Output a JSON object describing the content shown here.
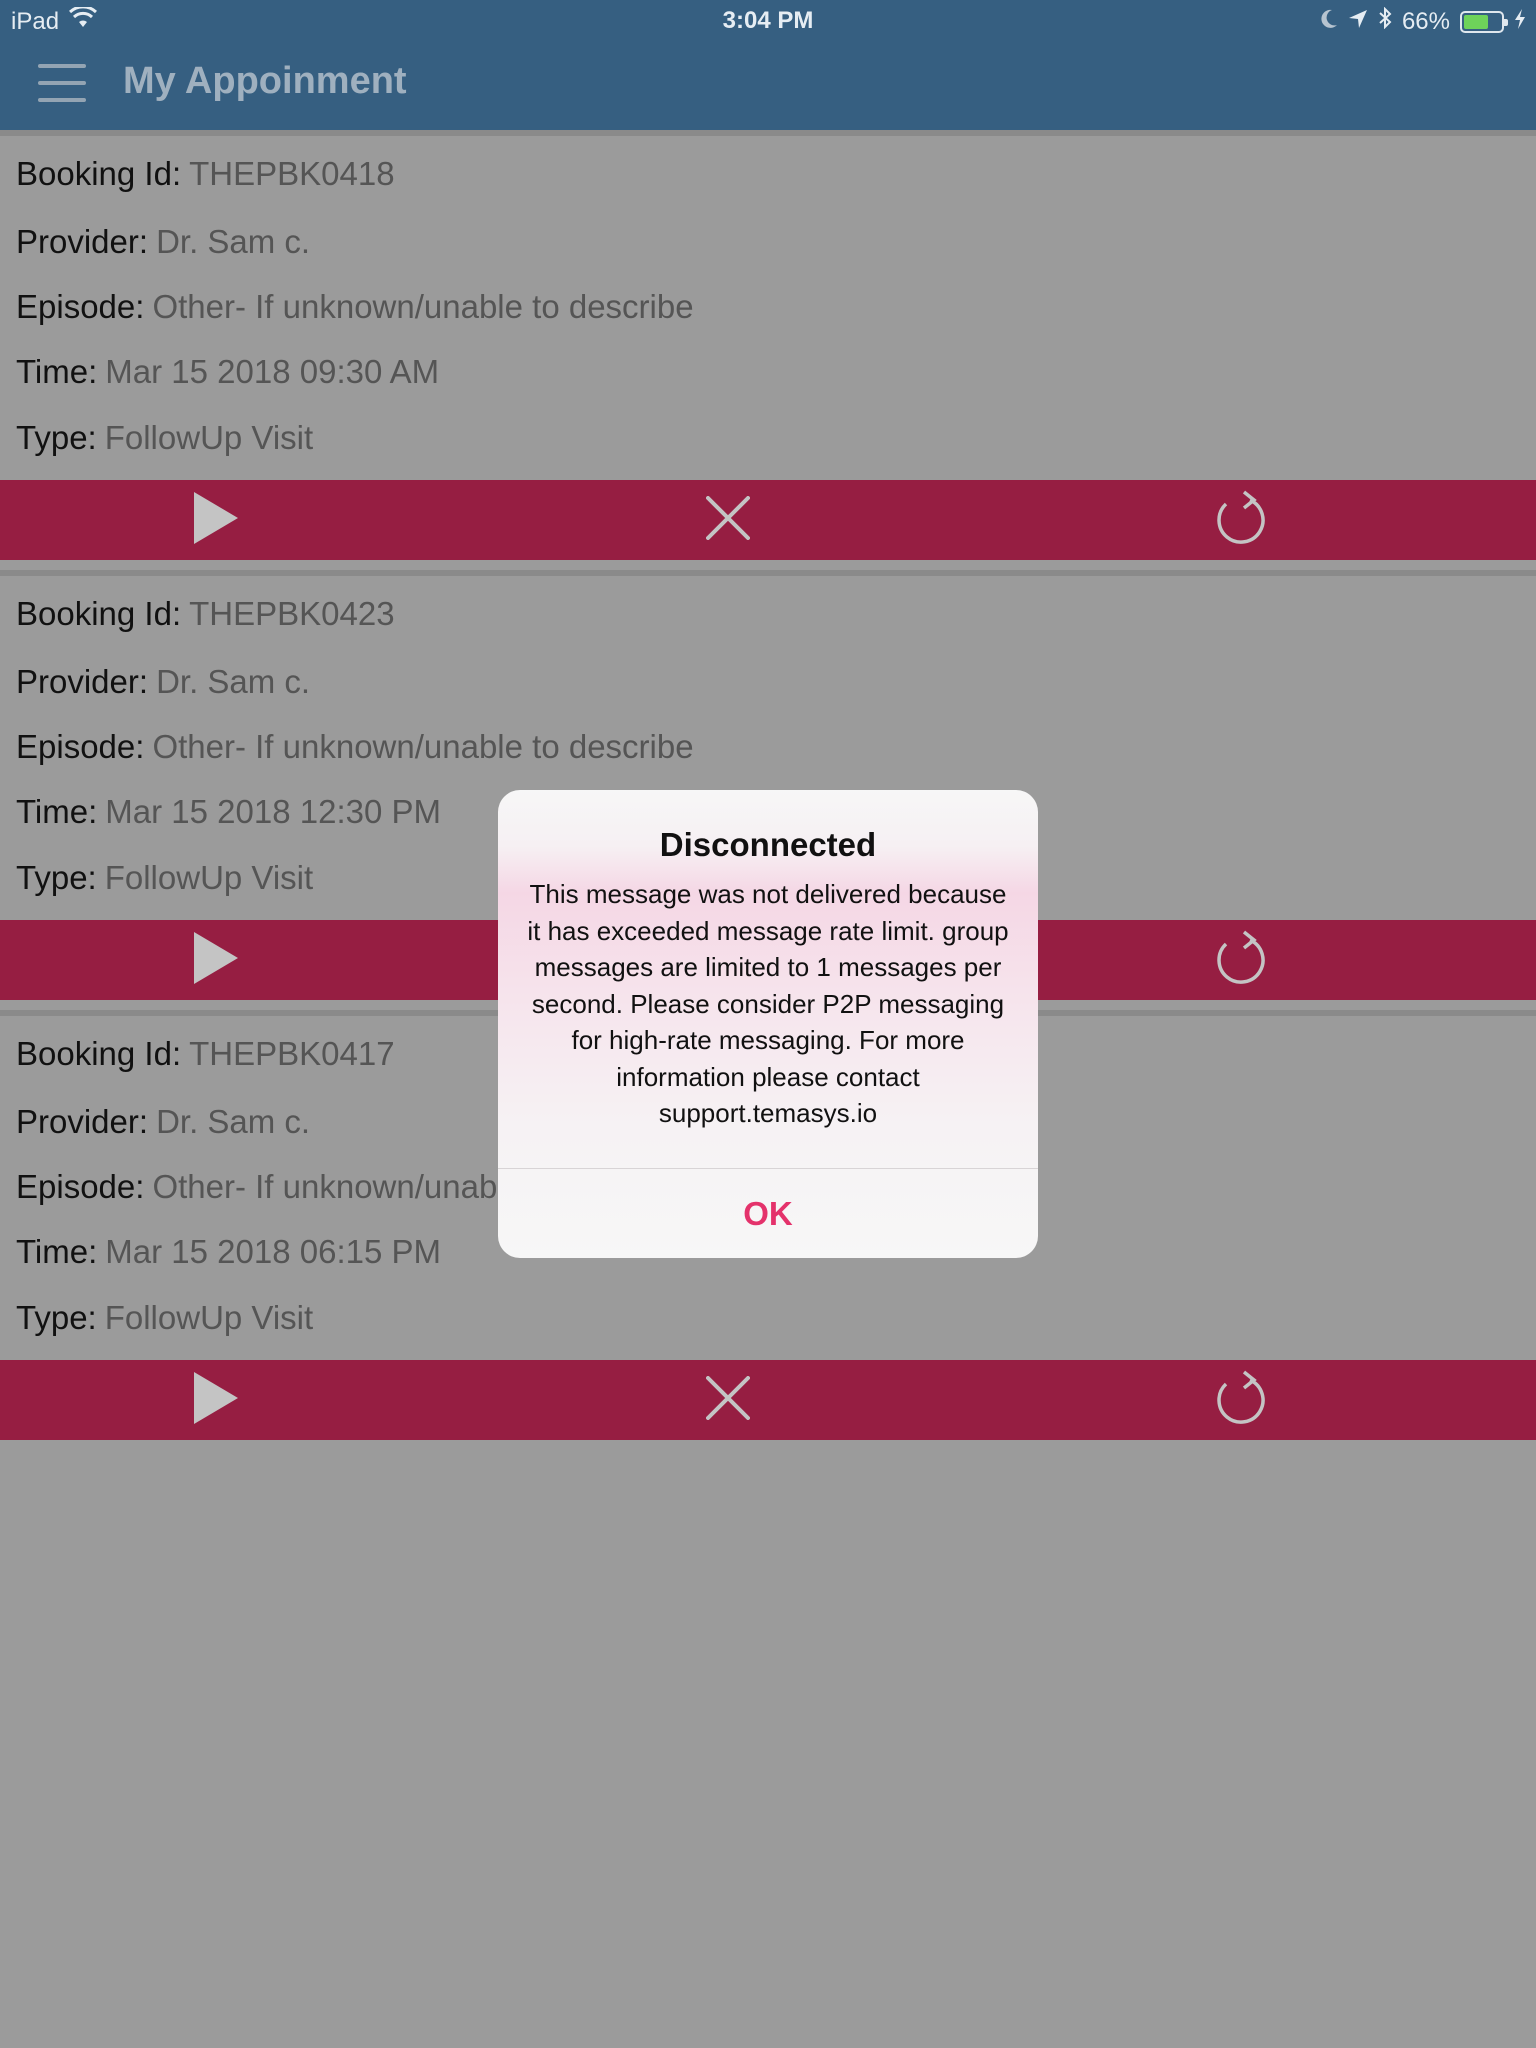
{
  "status_bar": {
    "device": "iPad",
    "time": "3:04 PM",
    "battery_percent": "66%",
    "battery_level": 0.66,
    "icons": [
      "wifi-icon",
      "moon-icon",
      "location-icon",
      "bluetooth-icon",
      "battery-icon",
      "charging-icon"
    ]
  },
  "header": {
    "title": "My Appoinment",
    "menu_icon": "hamburger-icon"
  },
  "labels": {
    "booking_id": "Booking Id:",
    "provider": "Provider:",
    "episode": "Episode:",
    "time": "Time:",
    "type": "Type:"
  },
  "appointments": [
    {
      "booking_id": "THEPBK0418",
      "provider": "Dr. Sam c.",
      "episode": "Other- If unknown/unable to describe",
      "time": "Mar 15 2018 09:30 AM",
      "type": "FollowUp Visit"
    },
    {
      "booking_id": "THEPBK0423",
      "provider": "Dr. Sam c.",
      "episode": "Other- If unknown/unable to describe",
      "time": "Mar 15 2018 12:30 PM",
      "type": "FollowUp Visit"
    },
    {
      "booking_id": "THEPBK0417",
      "provider": "Dr. Sam c.",
      "episode": "Other- If unknown/unable to describe",
      "time": "Mar 15 2018 06:15 PM",
      "type": "FollowUp Visit"
    }
  ],
  "actions": [
    "play-icon",
    "close-icon",
    "refresh-icon"
  ],
  "dialog": {
    "title": "Disconnected",
    "message": "This message was not delivered because it has exceeded message rate limit. group messages are limited to 1 messages per second. Please consider P2P messaging for high-rate messaging.    For more information please contact support.temasys.io",
    "ok_label": "OK"
  },
  "colors": {
    "header": "#365f81",
    "action_bar": "#961e42",
    "overlay_background": "#9b9b9b",
    "dialog_button": "#e4326b"
  }
}
